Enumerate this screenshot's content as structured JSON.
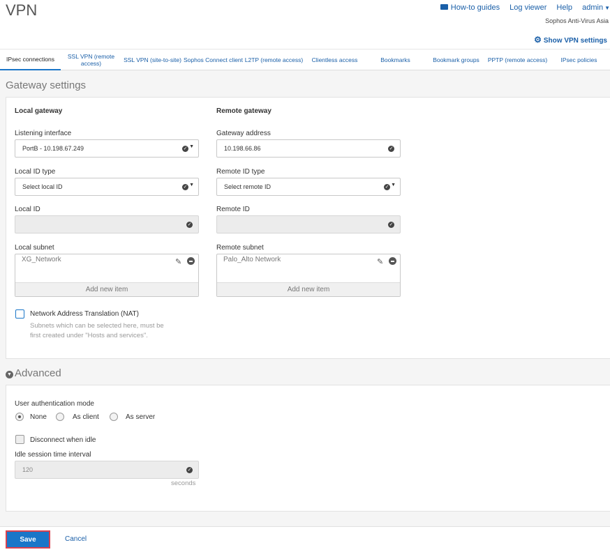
{
  "header": {
    "title": "VPN",
    "links": {
      "howto": "How-to guides",
      "logviewer": "Log viewer",
      "help": "Help",
      "admin": "admin"
    },
    "org": "Sophos Anti-Virus Asia",
    "show_vpn_settings": "Show VPN settings",
    "icons": {
      "howto": "video-camera-icon",
      "settings": "gear-icon"
    }
  },
  "tabs": [
    {
      "label": "IPsec connections",
      "active": true
    },
    {
      "label": "SSL VPN (remote access)"
    },
    {
      "label": "SSL VPN (site-to-site)"
    },
    {
      "label": "Sophos Connect client"
    },
    {
      "label": "L2TP (remote access)"
    },
    {
      "label": "Clientless access"
    },
    {
      "label": "Bookmarks"
    },
    {
      "label": "Bookmark groups"
    },
    {
      "label": "PPTP (remote access)"
    },
    {
      "label": "IPsec policies"
    }
  ],
  "gateway": {
    "section_title": "Gateway settings",
    "local": {
      "heading": "Local gateway",
      "listening_interface_label": "Listening interface",
      "listening_interface_value": "PortB - 10.198.67.249",
      "id_type_label": "Local ID type",
      "id_type_value": "Select local ID",
      "id_label": "Local ID",
      "id_value": "",
      "subnet_label": "Local subnet",
      "subnet_item": "XG_Network",
      "add_new": "Add new item"
    },
    "remote": {
      "heading": "Remote gateway",
      "address_label": "Gateway address",
      "address_value": "10.198.66.86",
      "id_type_label": "Remote ID type",
      "id_type_value": "Select remote ID",
      "id_label": "Remote ID",
      "id_value": "",
      "subnet_label": "Remote subnet",
      "subnet_item": "Palo_Alto Network",
      "add_new": "Add new item"
    },
    "nat_label": "Network Address Translation (NAT)",
    "nat_checked": false,
    "nat_hint_1": "Subnets which can be selected here, must be",
    "nat_hint_2": "first created under \"Hosts and services\"."
  },
  "advanced": {
    "section_title": "Advanced",
    "auth_mode_label": "User authentication mode",
    "auth_options": [
      "None",
      "As client",
      "As server"
    ],
    "auth_selected": "None",
    "disconnect_label": "Disconnect when idle",
    "disconnect_checked": false,
    "idle_interval_label": "Idle session time interval",
    "idle_interval_value": "120",
    "idle_interval_unit": "seconds"
  },
  "footer": {
    "save": "Save",
    "cancel": "Cancel"
  },
  "colors": {
    "accent": "#1a76c8",
    "link": "#1a5fa8",
    "save_border": "#d9414e"
  }
}
